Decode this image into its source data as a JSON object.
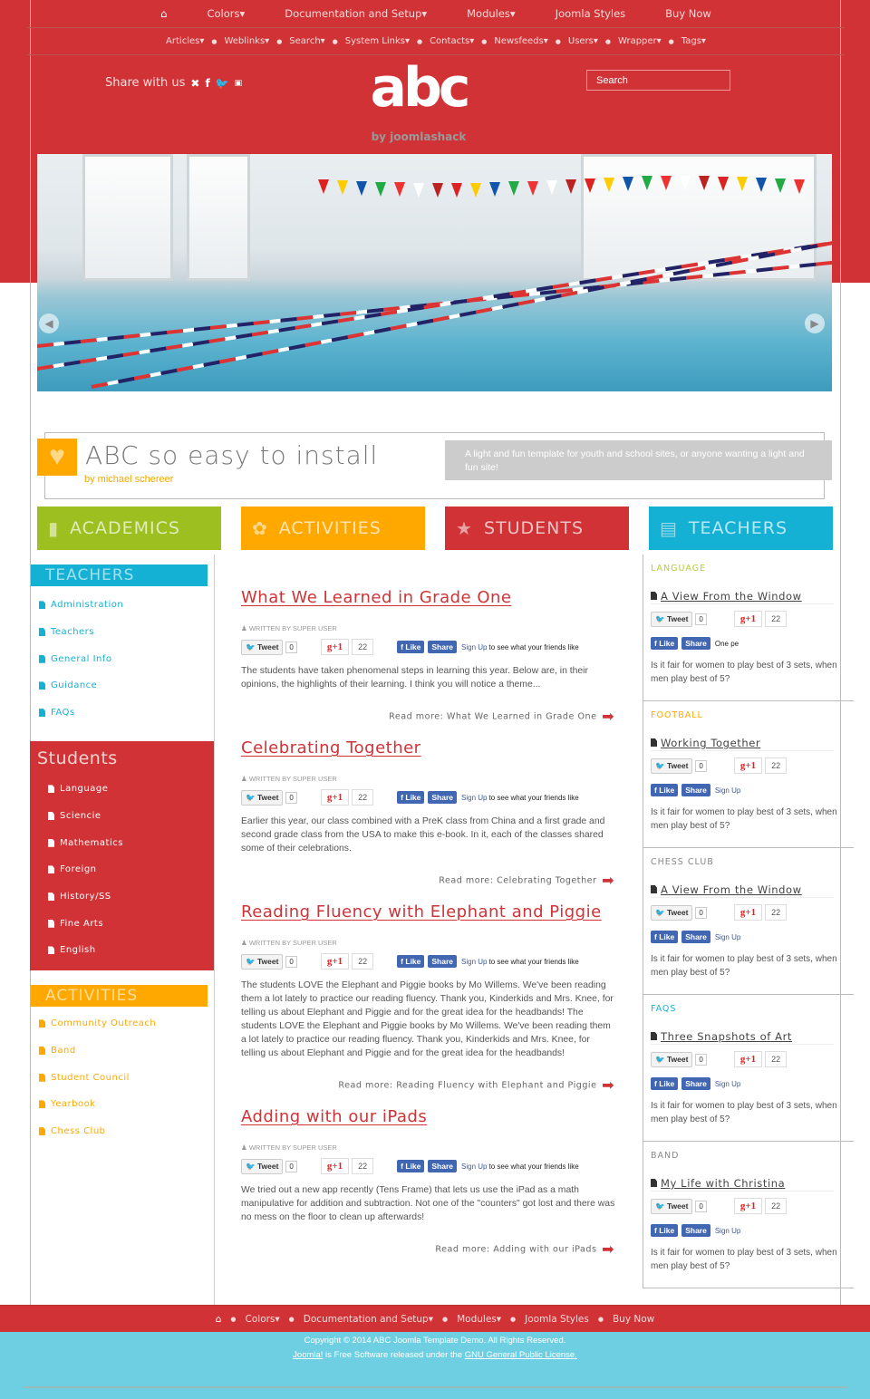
{
  "colors": {
    "red": "#d03236",
    "orange": "#fea800",
    "green": "#9dbf1f",
    "blue": "#14b1d4",
    "footer_blue": "#6fcfe2"
  },
  "nav_main": [
    "Colors▾",
    "Documentation and Setup▾",
    "Modules▾",
    "Joomla Styles",
    "Buy Now"
  ],
  "nav_sub": [
    "Articles▾",
    "Weblinks▾",
    "Search▾",
    "System Links▾",
    "Contacts▾",
    "Newsfeeds▾",
    "Users▾",
    "Wrapper▾",
    "Tags▾"
  ],
  "header": {
    "share_label": "Share with us",
    "logo_text": "abc",
    "logo_by": "by joomlashack",
    "search_placeholder": "Search"
  },
  "feature": {
    "title": "ABC so easy to install",
    "byline": "by michael schereer",
    "description": "A light and fun template for youth and school sites, or anyone wanting a light and fun site!"
  },
  "tiles": [
    {
      "label": "ACADEMICS",
      "icon": "folder-icon"
    },
    {
      "label": "ACTIVITIES",
      "icon": "palette-icon"
    },
    {
      "label": "STUDENTS",
      "icon": "star-icon"
    },
    {
      "label": "TEACHERS",
      "icon": "document-icon"
    }
  ],
  "left": {
    "teachers": {
      "title": "TEACHERS",
      "items": [
        "Administration",
        "Teachers",
        "General Info",
        "Guidance",
        "FAQs"
      ]
    },
    "students": {
      "title": "Students",
      "items": [
        "Language",
        "Sciencie",
        "Mathematics",
        "Foreign",
        "History/SS",
        "Fine Arts",
        "English"
      ]
    },
    "activities": {
      "title": "ACTIVITIES",
      "items": [
        "Community Outreach",
        "Band",
        "Student Council",
        "Yearbook",
        "Chess Club"
      ]
    }
  },
  "social": {
    "tweet": "Tweet",
    "tweet_count": "0",
    "gplus": "+1",
    "gplus_count": "22",
    "like": "Like",
    "share": "Share",
    "signup": "Sign Up",
    "signup_suffix": "to see what your friends like",
    "one_pe": "One pe",
    "sign_up_short": "Sign Up"
  },
  "articles": [
    {
      "title": "What We Learned in Grade One",
      "author": "WRITTEN BY SUPER USER",
      "text": "The students have taken phenomenal steps in learning this year. Below are, in their opinions, the highlights of their learning. I think you will notice a theme...",
      "read_more": "Read more: What We Learned in Grade One"
    },
    {
      "title": "Celebrating Together",
      "author": "WRITTEN BY SUPER USER",
      "text": "Earlier this year, our class combined with a PreK class from China and a first grade and second grade class from the USA to make this e-book. In it, each of the classes shared some of their celebrations.",
      "read_more": "Read more: Celebrating Together"
    },
    {
      "title": "Reading Fluency with Elephant and Piggie",
      "author": "WRITTEN BY SUPER USER",
      "text": "The students LOVE the Elephant and Piggie books by Mo Willems. We've been reading them a lot lately to practice our reading fluency. Thank you, Kinderkids and Mrs. Knee, for telling us about Elephant and Piggie and for the great idea for the headbands! The students LOVE the Elephant and Piggie books by Mo Willems. We've been reading them a lot lately to practice our reading fluency. Thank you, Kinderkids and Mrs. Knee, for telling us about Elephant and Piggie and for the great idea for the headbands!",
      "read_more": "Read more: Reading Fluency with Elephant and Piggie"
    },
    {
      "title": "Adding with our iPads",
      "author": "WRITTEN BY SUPER USER",
      "text": "We tried out a new app recently (Tens Frame) that lets us use the iPad as a math manipulative for addition and subtraction. Not one of the \"counters\" got lost and there was no mess on the floor to clean up afterwards!",
      "read_more": "Read more: Adding with our iPads"
    }
  ],
  "right_modules": [
    {
      "heading": "LANGUAGE",
      "color": "#b5cc3a",
      "title": "A View From the Window",
      "fb_suffix": "One pe",
      "text": "Is it fair for women to play best of 3 sets, when men play best of 5?"
    },
    {
      "heading": "FOOTBALL",
      "color": "#fea800",
      "title": "Working Together",
      "fb_suffix": "Sign Up",
      "text": "Is it fair for women to play best of 3 sets, when men play best of 5?"
    },
    {
      "heading": "CHESS CLUB",
      "color": "#888888",
      "title": "A View From the Window",
      "fb_suffix": "Sign Up",
      "text": "Is it fair for women to play best of 3 sets, when men play best of 5?"
    },
    {
      "heading": "FAQS",
      "color": "#14b1d4",
      "title": "Three Snapshots of Art",
      "fb_suffix": "Sign Up",
      "text": "Is it fair for women to play best of 3 sets, when men play best of 5?"
    },
    {
      "heading": "BAND",
      "color": "#888888",
      "title": "My Life with Christina",
      "fb_suffix": "Sign Up",
      "text": "Is it fair for women to play best of 3 sets, when men play best of 5?"
    }
  ],
  "footer": {
    "nav": [
      "Colors▾",
      "Documentation and Setup▾",
      "Modules▾",
      "Joomla Styles",
      "Buy Now"
    ],
    "copyright": "Copyright © 2014 ABC Joomla Template Demo. All Rights Reserved.",
    "joomla_link": "Joomla!",
    "license_mid": " is Free Software released under the ",
    "license_link": "GNU General Public License."
  }
}
